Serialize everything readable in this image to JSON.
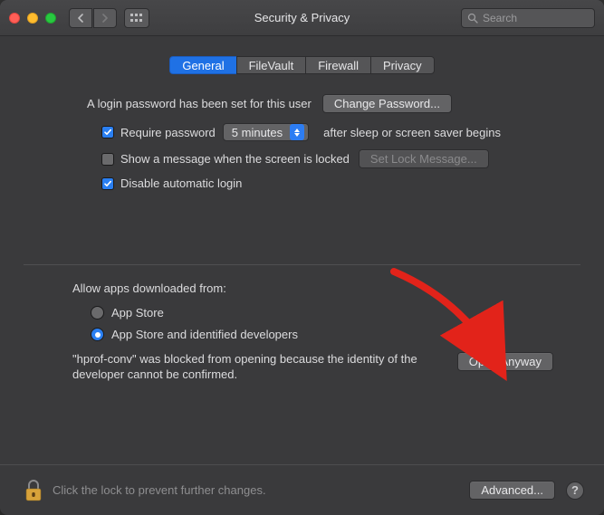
{
  "window": {
    "title": "Security & Privacy",
    "search_placeholder": "Search"
  },
  "tabs": [
    "General",
    "FileVault",
    "Firewall",
    "Privacy"
  ],
  "general": {
    "login_password_label": "A login password has been set for this user",
    "change_password_btn": "Change Password...",
    "require_password_label": "Require password",
    "require_password_delay": "5 minutes",
    "require_password_after": "after sleep or screen saver begins",
    "show_message_label": "Show a message when the screen is locked",
    "set_lock_msg_btn": "Set Lock Message...",
    "disable_auto_login_label": "Disable automatic login"
  },
  "gatekeeper": {
    "heading": "Allow apps downloaded from:",
    "option_appstore": "App Store",
    "option_identified": "App Store and identified developers",
    "blocked_msg": "\"hprof-conv\" was blocked from opening because the identity of the developer cannot be confirmed.",
    "open_anyway_btn": "Open Anyway"
  },
  "footer": {
    "lock_msg": "Click the lock to prevent further changes.",
    "advanced_btn": "Advanced...",
    "help": "?"
  }
}
